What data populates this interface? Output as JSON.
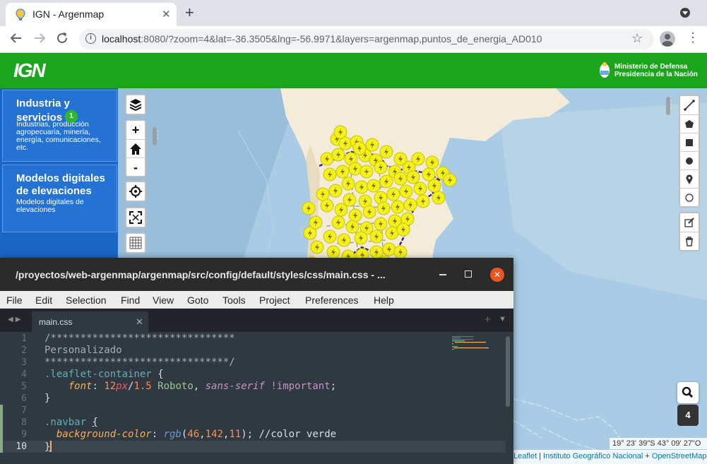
{
  "browser": {
    "tab_title": "IGN - Argenmap",
    "url_host": "localhost",
    "url_rest": ":8080/?zoom=4&lat=-36.3505&lng=-56.9971&layers=argenmap,puntos_de_energia_AD010"
  },
  "header": {
    "logo": "IGN",
    "ministry_line1": "Ministerio de Defensa",
    "ministry_line2": "Presidencia de la Nación"
  },
  "sidebar": {
    "categories": [
      {
        "title_line1": "Industria y",
        "title_line2": "servicios",
        "badge": "1",
        "description": "Industrias, producción agropecuaria, minería, energía, comunicaciones, etc."
      },
      {
        "title": "Modelos digitales de elevaciones",
        "description": "Modelos digitales de elevaciones"
      }
    ]
  },
  "map": {
    "zoom_in": "+",
    "zoom_out": "-",
    "coordinates": "19° 23' 39\"S 43° 09' 27\"O",
    "attribution": {
      "leaflet": "Leaflet",
      "sep": " | ",
      "ign": "Instituto Geográfico Nacional",
      "plus": " + ",
      "osm": "OpenStreetMap"
    },
    "layer_count": "4",
    "icons": {
      "layers": "layers-icon",
      "home": "home-icon",
      "locate": "crosshair-icon",
      "fullscreen": "fullscreen-icon",
      "graticule": "grid-icon",
      "search": "search-icon"
    },
    "colors": {
      "header_green": "#1aa51d",
      "sidebar_blue": "#1a66c4",
      "marker_yellow": "#f4ef1e",
      "land": "#f3ecd9",
      "sea": "#a9cbe4"
    }
  },
  "editor": {
    "window_title": "/proyectos/web-argenmap/argenmap/src/config/default/styles/css/main.css - ...",
    "menu": [
      "File",
      "Edit",
      "Selection",
      "Find",
      "View",
      "Goto",
      "Tools",
      "Project",
      "Preferences",
      "Help"
    ],
    "tab_name": "main.css",
    "line_numbers": [
      "1",
      "2",
      "3",
      "4",
      "5",
      "6",
      "7",
      "8",
      "9",
      "10"
    ],
    "code": {
      "l1": "/*******************************",
      "l2": "Personalizado",
      "l3": "*******************************/",
      "l4_sel": ".leaflet-container",
      "l4_brace": " {",
      "l5_prop": "font",
      "l5_colon": ": ",
      "l5_num1": "12",
      "l5_unit": "px",
      "l5_slash": "/",
      "l5_num2": "1.5",
      "l5_font": " Roboto",
      "l5_comma": ", ",
      "l5_family": "sans-serif",
      "l5_imp": " !important",
      "l5_semi": ";",
      "l6": "}",
      "l8_sel": ".navbar",
      "l8_brace": "{",
      "l9_prop": "background-color",
      "l9_colon": ": ",
      "l9_fn": "rgb",
      "l9_open": "(",
      "l9_n1": "46",
      "l9_c1": ",",
      "l9_n2": "142",
      "l9_c2": ",",
      "l9_n3": "11",
      "l9_close": ");",
      "l9_comment": " //color verde",
      "l10": "}"
    }
  }
}
